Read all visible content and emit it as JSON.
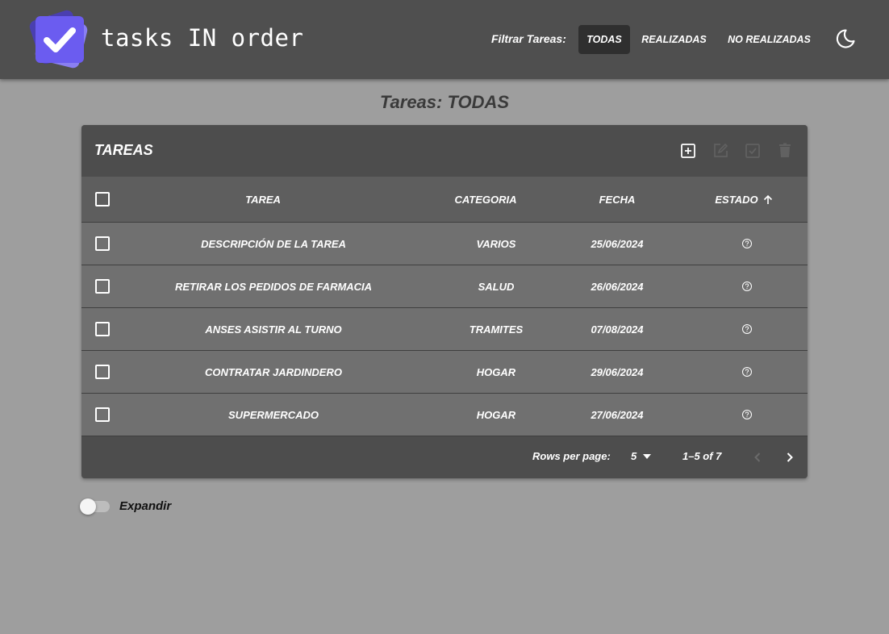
{
  "header": {
    "brand": "tasks IN order",
    "filter_label": "Filtrar Tareas:",
    "filters": [
      {
        "label": "TODAS",
        "active": true
      },
      {
        "label": "REALIZADAS",
        "active": false
      },
      {
        "label": "NO REALIZADAS",
        "active": false
      }
    ],
    "theme_toggle_icon": "moon-icon"
  },
  "page_title": "Tareas: TODAS",
  "table": {
    "title": "TAREAS",
    "toolbar_icons": [
      "add-box-icon",
      "edit-icon",
      "check-box-icon",
      "delete-icon"
    ],
    "columns": [
      "TAREA",
      "CATEGORIA",
      "FECHA",
      "ESTADO"
    ],
    "sort_icon": "arrow-up-icon",
    "rows": [
      {
        "tarea": "DESCRIPCIÓN DE LA TAREA",
        "categoria": "VARIOS",
        "fecha": "25/06/2024",
        "estado_icon": "help-circle-icon"
      },
      {
        "tarea": "RETIRAR LOS PEDIDOS DE FARMACIA",
        "categoria": "SALUD",
        "fecha": "26/06/2024",
        "estado_icon": "help-circle-icon"
      },
      {
        "tarea": "ANSES ASISTIR AL TURNO",
        "categoria": "TRAMITES",
        "fecha": "07/08/2024",
        "estado_icon": "help-circle-icon"
      },
      {
        "tarea": "CONTRATAR JARDINDERO",
        "categoria": "HOGAR",
        "fecha": "29/06/2024",
        "estado_icon": "help-circle-icon"
      },
      {
        "tarea": "SUPERMERCADO",
        "categoria": "HOGAR",
        "fecha": "27/06/2024",
        "estado_icon": "help-circle-icon"
      }
    ],
    "pagination": {
      "rows_per_page_label": "Rows per page:",
      "rows_per_page_value": "5",
      "range": "1–5 of 7"
    }
  },
  "expand_toggle": {
    "label": "Expandir",
    "checked": false
  },
  "colors": {
    "logo_accent": "#6b5cf0",
    "header_bg": "#4f4f4f",
    "page_bg": "#9e9e9e"
  }
}
